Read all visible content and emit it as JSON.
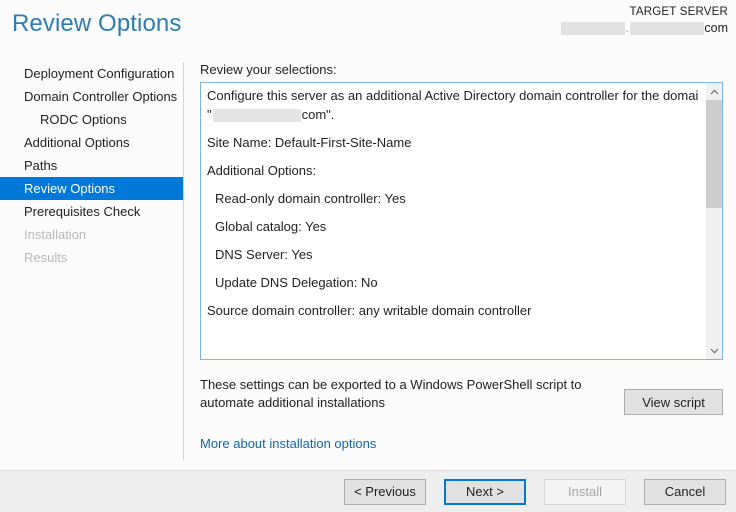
{
  "header": {
    "title": "Review Options",
    "target_server_label": "TARGET SERVER",
    "target_server_suffix": "com",
    "title_color": "#2e7cb0"
  },
  "sidebar": {
    "items": [
      {
        "label": "Deployment Configuration",
        "state": "normal",
        "sub": false
      },
      {
        "label": "Domain Controller Options",
        "state": "normal",
        "sub": false
      },
      {
        "label": "RODC Options",
        "state": "normal",
        "sub": true
      },
      {
        "label": "Additional Options",
        "state": "normal",
        "sub": false
      },
      {
        "label": "Paths",
        "state": "normal",
        "sub": false
      },
      {
        "label": "Review Options",
        "state": "selected",
        "sub": false
      },
      {
        "label": "Prerequisites Check",
        "state": "normal",
        "sub": false
      },
      {
        "label": "Installation",
        "state": "disabled",
        "sub": false
      },
      {
        "label": "Results",
        "state": "disabled",
        "sub": false
      }
    ],
    "selected_color": "#0078d7"
  },
  "main": {
    "review_label": "Review your selections:",
    "selections": {
      "intro": "Configure this server as an additional Active Directory domain controller for the domain",
      "domain_quote_open": "\"",
      "domain_quote_suffix": "com\".",
      "site_name": "Site Name: Default-First-Site-Name",
      "additional_options_heading": "Additional Options:",
      "options": [
        "Read-only domain controller: Yes",
        "Global catalog: Yes",
        "DNS Server: Yes",
        "Update DNS Delegation: No"
      ],
      "source_dc": "Source domain controller: any writable domain controller"
    },
    "scrollbar": {
      "up_arrow": "chevron-up-icon",
      "down_arrow": "chevron-down-icon"
    },
    "export_text": "These settings can be exported to a Windows PowerShell script to automate additional installations",
    "view_script_label": "View script",
    "more_link": "More about installation options",
    "link_color": "#1367a7"
  },
  "footer": {
    "previous_label": "< Previous",
    "next_label": "Next >",
    "install_label": "Install",
    "cancel_label": "Cancel"
  }
}
